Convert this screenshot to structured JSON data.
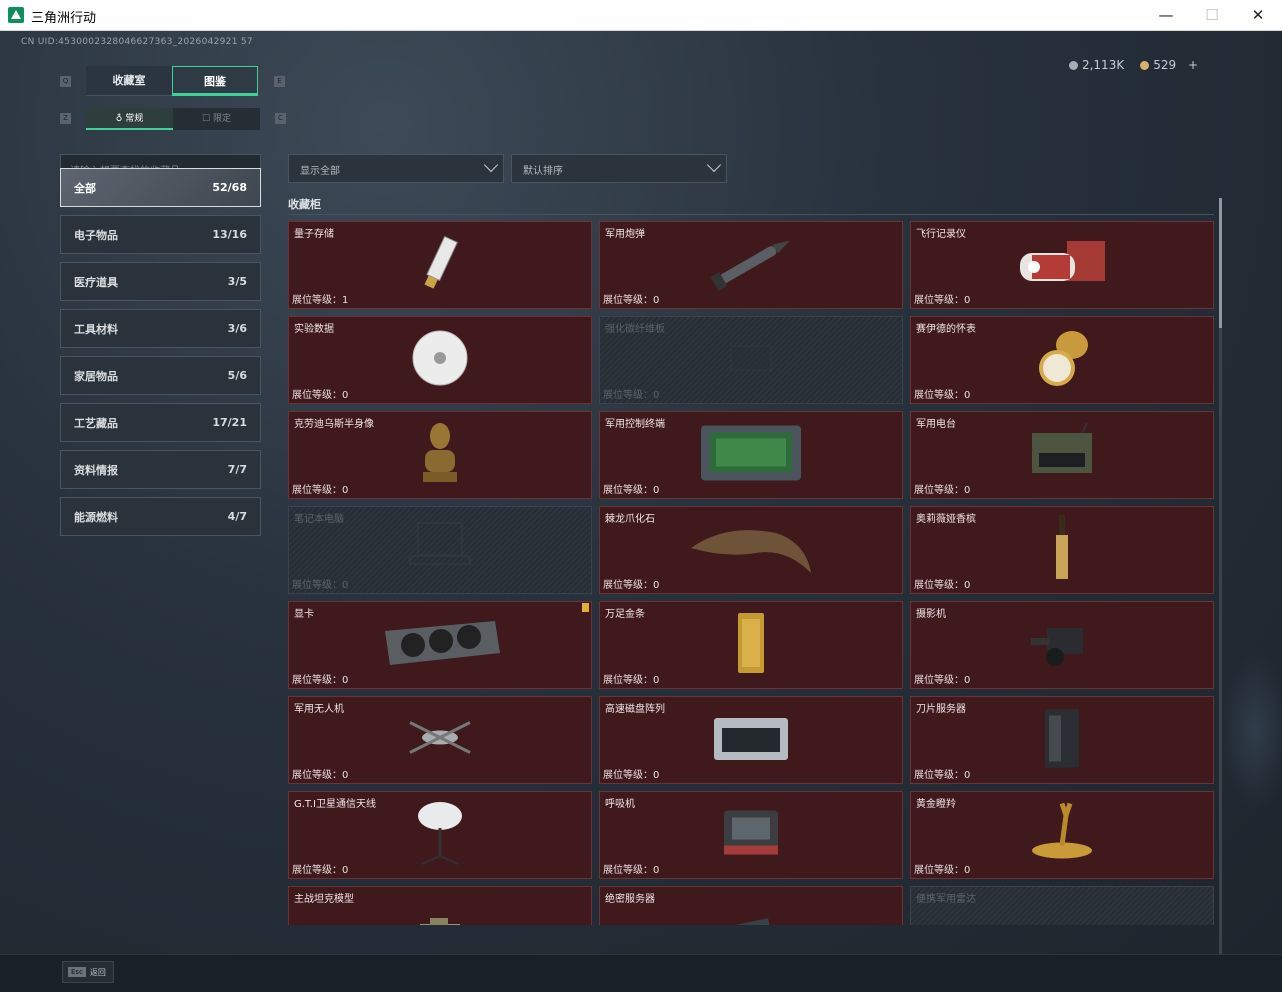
{
  "window": {
    "title": "三角洲行动",
    "minimize": "—",
    "maximize": "☐",
    "close": "✕"
  },
  "uid": "CN UID:4530002328046627363_2026042921 57",
  "currency": {
    "silver": "2,113K",
    "gold": "529",
    "plus": "+"
  },
  "tabs": [
    "收藏室",
    "图鉴"
  ],
  "subtabs": [
    "常规",
    "限定"
  ],
  "search": {
    "placeholder": "请输入想要查找的收藏品"
  },
  "filters": {
    "show": "显示全部",
    "sort": "默认排序"
  },
  "categories": [
    {
      "label": "全部",
      "count": "52/68"
    },
    {
      "label": "电子物品",
      "count": "13/16"
    },
    {
      "label": "医疗道具",
      "count": "3/5"
    },
    {
      "label": "工具材料",
      "count": "3/6"
    },
    {
      "label": "家居物品",
      "count": "5/6"
    },
    {
      "label": "工艺藏品",
      "count": "17/21"
    },
    {
      "label": "资料情报",
      "count": "7/7"
    },
    {
      "label": "能源燃料",
      "count": "4/7"
    }
  ],
  "section": "收藏柜",
  "items": [
    {
      "name": "量子存储",
      "level": "展位等级：1",
      "icon": "usb-drive-icon"
    },
    {
      "name": "军用炮弹",
      "level": "展位等级：0",
      "icon": "shell-icon"
    },
    {
      "name": "飞行记录仪",
      "level": "展位等级：0",
      "icon": "flight-recorder-icon"
    },
    {
      "name": "实验数据",
      "level": "展位等级：0",
      "icon": "disc-icon"
    },
    {
      "name": "强化碳纤维板",
      "level": "展位等级：0",
      "icon": "locked-icon",
      "locked": true
    },
    {
      "name": "赛伊德的怀表",
      "level": "展位等级：0",
      "icon": "pocket-watch-icon"
    },
    {
      "name": "克劳迪乌斯半身像",
      "level": "展位等级：0",
      "icon": "bust-icon"
    },
    {
      "name": "军用控制终端",
      "level": "展位等级：0",
      "icon": "terminal-icon"
    },
    {
      "name": "军用电台",
      "level": "展位等级：0",
      "icon": "radio-icon"
    },
    {
      "name": "笔记本电脑",
      "level": "展位等级：0",
      "icon": "laptop-icon",
      "locked": true
    },
    {
      "name": "棘龙爪化石",
      "level": "展位等级：0",
      "icon": "claw-icon"
    },
    {
      "name": "奥莉薇娅香槟",
      "level": "展位等级：0",
      "icon": "champagne-icon"
    },
    {
      "name": "显卡",
      "level": "展位等级：0",
      "icon": "gpu-icon",
      "badge": true
    },
    {
      "name": "万足金条",
      "level": "展位等级：0",
      "icon": "gold-bar-icon"
    },
    {
      "name": "摄影机",
      "level": "展位等级：0",
      "icon": "camera-icon"
    },
    {
      "name": "军用无人机",
      "level": "展位等级：0",
      "icon": "drone-icon"
    },
    {
      "name": "高速磁盘阵列",
      "level": "展位等级：0",
      "icon": "disk-array-icon"
    },
    {
      "name": "刀片服务器",
      "level": "展位等级：0",
      "icon": "server-icon"
    },
    {
      "name": "G.T.I卫星通信天线",
      "level": "展位等级：0",
      "icon": "satellite-dish-icon"
    },
    {
      "name": "呼吸机",
      "level": "展位等级：0",
      "icon": "ventilator-icon"
    },
    {
      "name": "黄金瞪羚",
      "level": "展位等级：0",
      "icon": "gazelle-icon"
    },
    {
      "name": "主战坦克模型",
      "level": "",
      "icon": "tank-icon"
    },
    {
      "name": "绝密服务器",
      "level": "",
      "icon": "secret-server-icon"
    },
    {
      "name": "便携军用雷达",
      "level": "",
      "icon": "radar-icon",
      "locked": true
    }
  ],
  "esc": {
    "key": "Esc",
    "label": "返回"
  }
}
